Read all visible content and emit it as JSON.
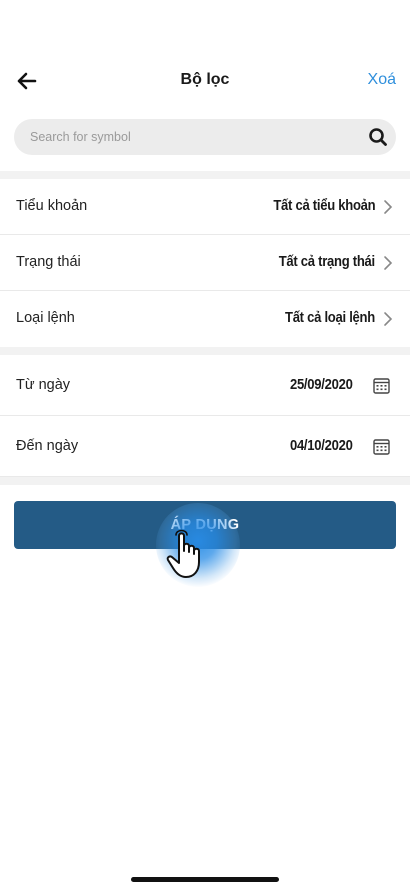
{
  "header": {
    "title": "Bộ lọc",
    "clear_label": "Xoá",
    "back_icon": "arrow-left-icon"
  },
  "search": {
    "placeholder": "Search for symbol",
    "value": "",
    "icon": "search-icon"
  },
  "filters": [
    {
      "label": "Tiểu khoản",
      "value": "Tất cả tiểu khoản"
    },
    {
      "label": "Trạng thái",
      "value": "Tất cả trạng thái"
    },
    {
      "label": "Loại lệnh",
      "value": "Tất cả loại lệnh"
    }
  ],
  "dates": [
    {
      "label": "Từ ngày",
      "value": "25/09/2020"
    },
    {
      "label": "Đến ngày",
      "value": "04/10/2020"
    }
  ],
  "apply_label": "ÁP DỤNG",
  "colors": {
    "accent_link": "#2f8fdc",
    "apply_button": "#245b86",
    "touch_indicator": "#288ce6"
  }
}
